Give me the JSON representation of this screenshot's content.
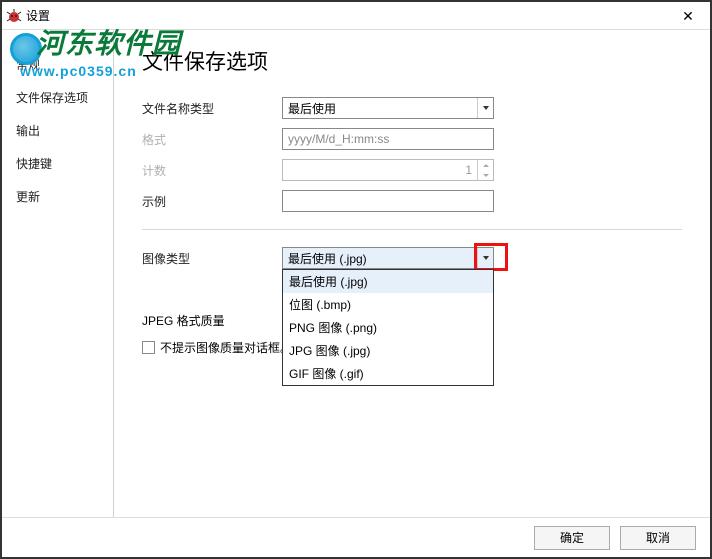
{
  "window": {
    "title": "设置",
    "close": "✕"
  },
  "watermark": {
    "text": "河东软件园",
    "url": "www.pc0359.cn"
  },
  "sidebar": {
    "items": [
      {
        "label": "常规"
      },
      {
        "label": "文件保存选项"
      },
      {
        "label": "输出"
      },
      {
        "label": "快捷键"
      },
      {
        "label": "更新"
      }
    ]
  },
  "content": {
    "heading": "文件保存选项",
    "filename_type": {
      "label": "文件名称类型",
      "value": "最后使用"
    },
    "format": {
      "label": "格式",
      "value": "yyyy/M/d_H:mm:ss"
    },
    "count": {
      "label": "计数",
      "value": "1"
    },
    "example": {
      "label": "示例",
      "value": ""
    },
    "image_type": {
      "label": "图像类型",
      "value": "最后使用 (.jpg)",
      "options": [
        "最后使用 (.jpg)",
        "位图 (.bmp)",
        "PNG 图像 (.png)",
        "JPG 图像 (.jpg)",
        "GIF 图像 (.gif)"
      ]
    },
    "jpeg": {
      "heading": "JPEG 格式质量",
      "checkbox_label": "不提示图像质量对话框。"
    }
  },
  "footer": {
    "ok": "确定",
    "cancel": "取消"
  }
}
